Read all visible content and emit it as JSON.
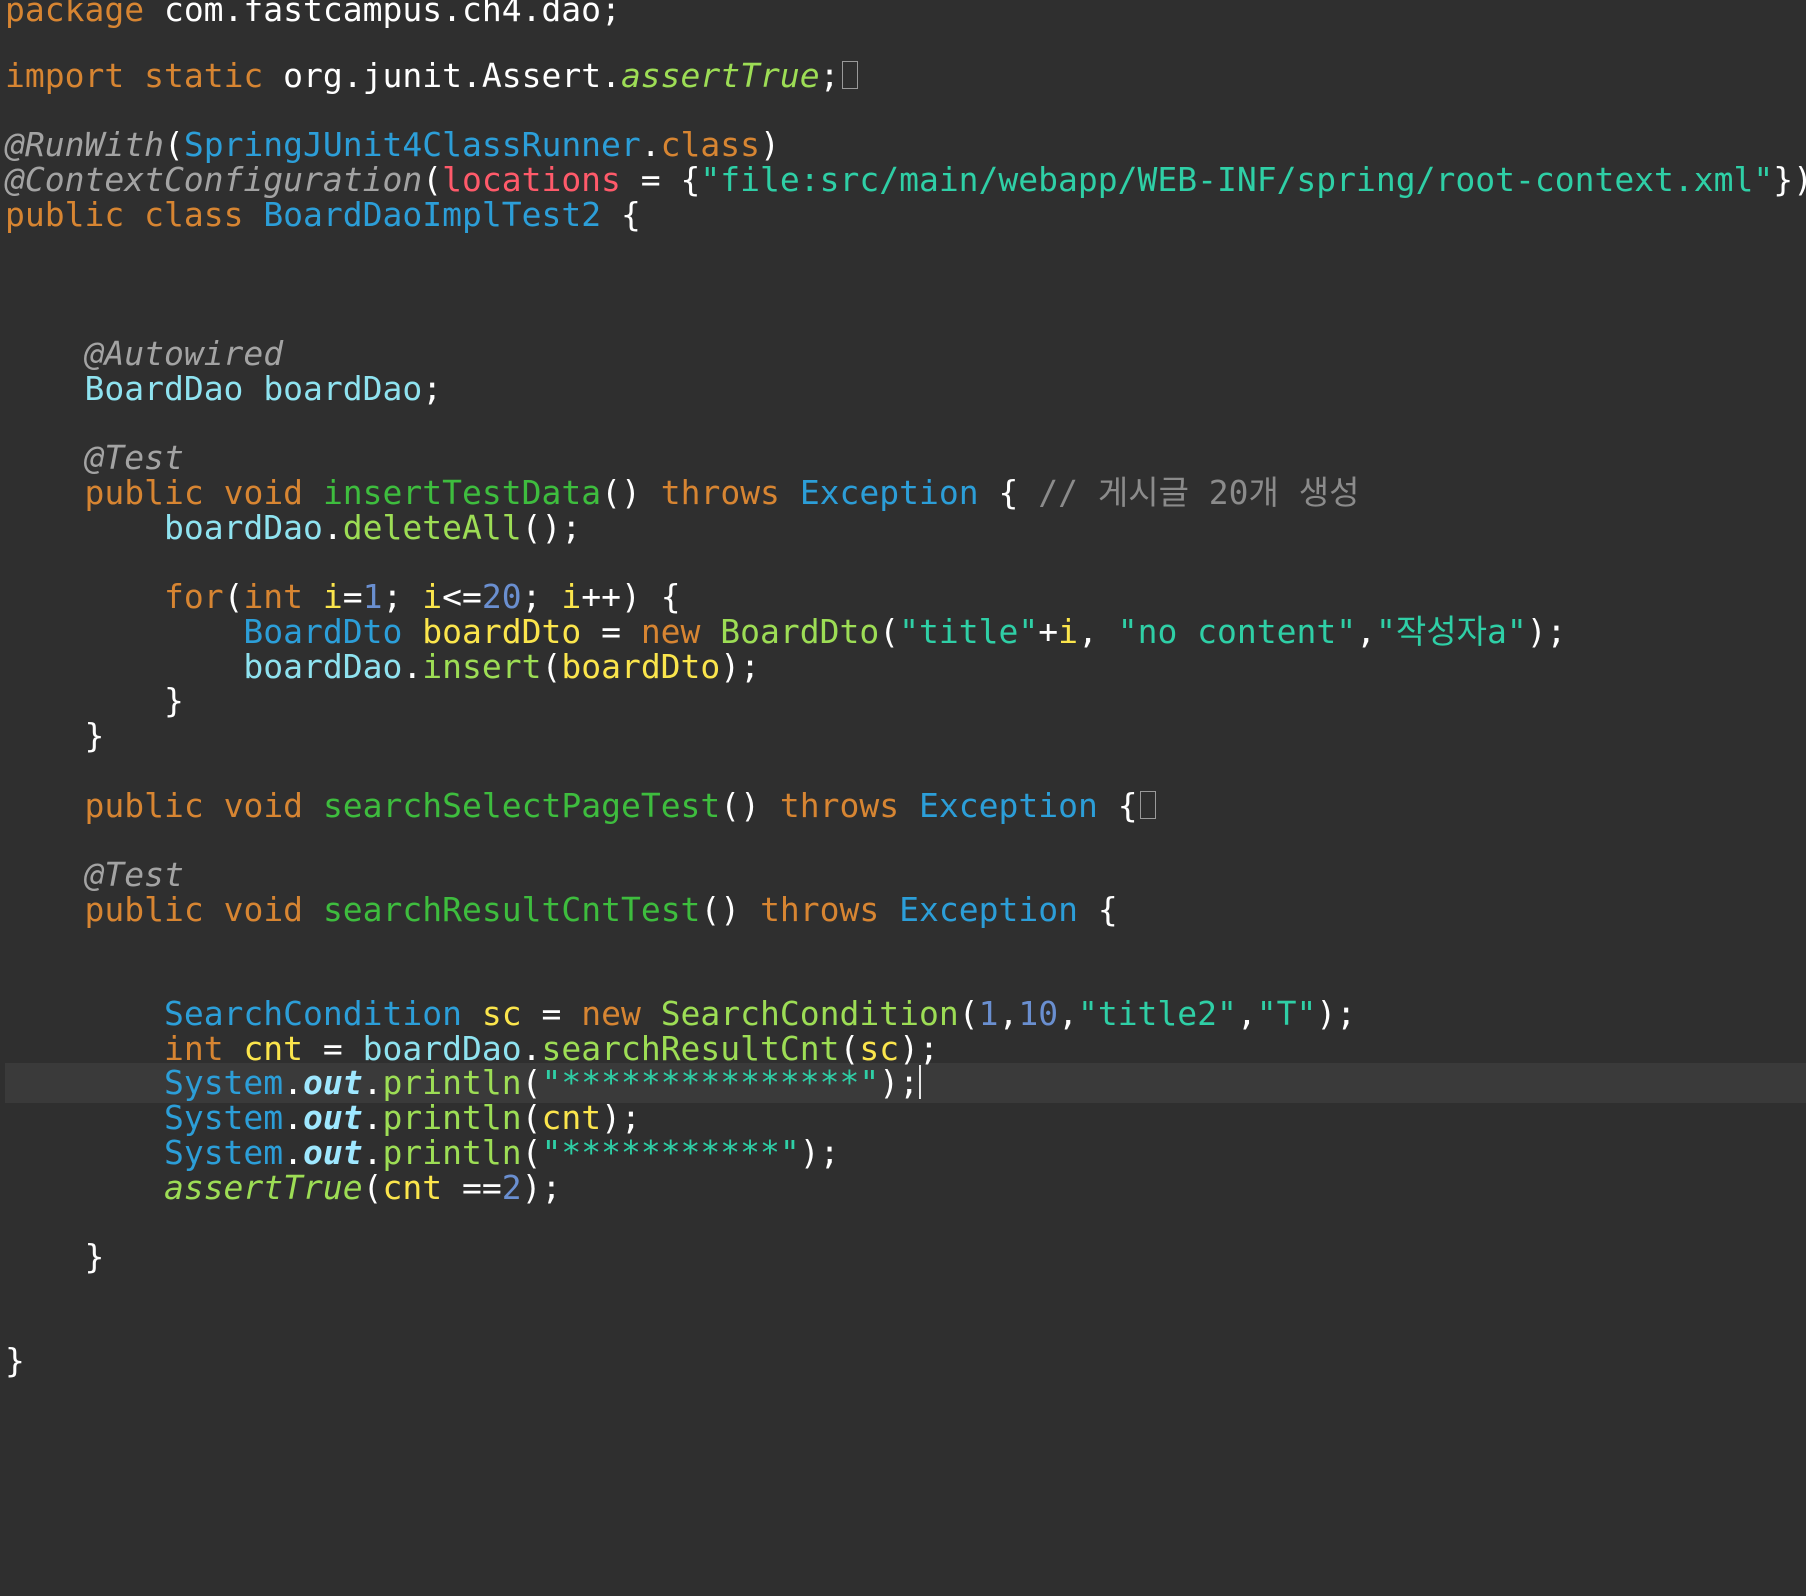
{
  "editor": {
    "lines": [
      "package com.fastcampus.ch4.dao;",
      "import static org.junit.Assert.assertTrue;",
      "@RunWith(SpringJUnit4ClassRunner.class)",
      "@ContextConfiguration(locations = {\"file:src/main/webapp/WEB-INF/spring/root-context.xml\"})",
      "public class BoardDaoImplTest2 {",
      "@Autowired",
      "BoardDao boardDao;",
      "@Test",
      "public void insertTestData() throws Exception { // 게시글 20개 생성",
      "boardDao.deleteAll();",
      "for(int i=1; i<=20; i++) {",
      "BoardDto boardDto = new BoardDto(\"title\"+i, \"no content\",\"작성자a\");",
      "boardDao.insert(boardDto);",
      "}",
      "}",
      "public void searchSelectPageTest() throws Exception {",
      "@Test",
      "public void searchResultCntTest() throws Exception {",
      "SearchCondition sc = new SearchCondition(1,10,\"title2\",\"T\");",
      "int cnt = boardDao.searchResultCnt(sc);",
      "System.out.println(\"***************\");",
      "System.out.println(cnt);",
      "System.out.println(\"***********\");",
      "assertTrue(cnt ==2);",
      "}",
      "}"
    ],
    "tokens": {
      "package": "package",
      "pkg": " com.fastcampus.ch4.dao;",
      "import": "import",
      "static": "static",
      "import_path": " org.junit.Assert.",
      "assertTrue": "assertTrue",
      "semi": ";",
      "runwith": "@RunWith",
      "lp": "(",
      "rp": ")",
      "runner": "SpringJUnit4ClassRunner",
      "dot": ".",
      "class_kw": "class",
      "ctxconf": "@ContextConfiguration",
      "locations": "locations",
      "eq_brace": " = {",
      "location_str": "\"file:src/main/webapp/WEB-INF/spring/root-context.xml\"",
      "close_brace_paren": "})",
      "public": "public",
      "class_name": "BoardDaoImplTest2",
      "open_brace": " {",
      "autowired": "@Autowired",
      "boarddao_type": "BoardDao",
      "boarddao_field": "boardDao",
      "test_ann": "@Test",
      "void": "void",
      "insert_method": "insertTestData",
      "parens": "()",
      "throws": "throws",
      "exception": "Exception",
      "brace": "{",
      "comment": "// 게시글 20개 생성",
      "deleteAll": "deleteAll",
      "call_end": "();",
      "for": "for",
      "int": "int",
      "i": "i",
      "eq": "=",
      "one": "1",
      "semi_sp": "; ",
      "le": "<=",
      "twenty": "20",
      "inc": "++",
      "close_paren_brace": ") {",
      "boarddto_type": "BoardDto",
      "boarddto_var": "boardDto",
      "assign": " = ",
      "new": "new",
      "title_str": "\"title\"",
      "plus": "+",
      "comma_sp": ", ",
      "nocontent_str": "\"no content\"",
      "comma": ",",
      "author_str": "\"작성자a\"",
      "paren_semi": ");",
      "insert": "insert",
      "close_brace": "}",
      "search_page_method": "searchSelectPageTest",
      "search_cnt_method": "searchResultCntTest",
      "searchcond_type": "SearchCondition",
      "sc": "sc",
      "ten": "10",
      "title2_str": "\"title2\"",
      "t_str": "\"T\"",
      "cnt": "cnt",
      "searchResultCnt": "searchResultCnt",
      "system": "System",
      "out": "out",
      "println": "println",
      "stars15": "\"***************\"",
      "stars11": "\"***********\"",
      "eqeq": " ==",
      "two": "2"
    }
  },
  "colors": {
    "background": "#2f2f2f",
    "keyword": "#d78532",
    "annotation": "#a3a3a3",
    "type": "#2c9ed8",
    "field": "#8fe3f0",
    "local": "#fbe54c",
    "method_call": "#9ddd55",
    "method_decl": "#3ebd3e",
    "string": "#2fcfa6",
    "number": "#6a8fd0",
    "parameter": "#ff5a6a",
    "comment": "#8b8b8b",
    "current_line": "#3a3a3a"
  },
  "icons": {
    "fold": "folded-code-icon",
    "caret": "text-caret"
  }
}
